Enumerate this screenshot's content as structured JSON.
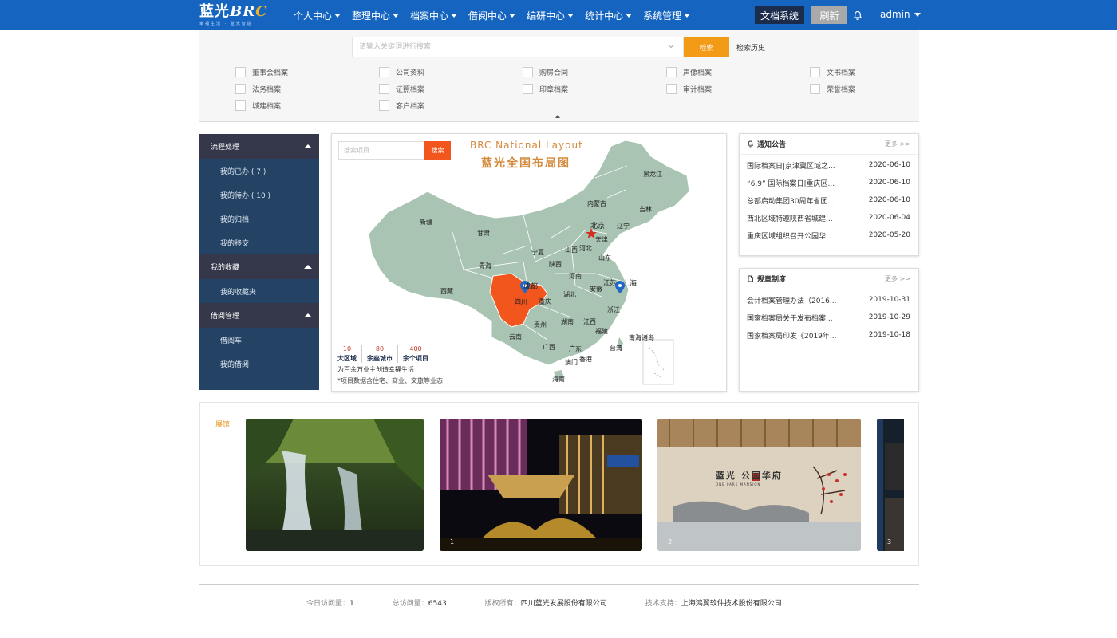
{
  "brand": {
    "logo_text_1": "蓝光",
    "logo_text_2": "BR",
    "logo_text_3": "C",
    "logo_sub": "幸福生活 · 蓝光智造",
    "primary_color": "#1565c0",
    "accent_color": "#f39a16"
  },
  "nav": {
    "items": [
      {
        "label": "个人中心"
      },
      {
        "label": "整理中心"
      },
      {
        "label": "档案中心"
      },
      {
        "label": "借阅中心"
      },
      {
        "label": "编研中心"
      },
      {
        "label": "统计中心"
      },
      {
        "label": "系统管理"
      }
    ],
    "doc_system_label": "文档系统",
    "refresh_label": "刷新",
    "user": "admin"
  },
  "search": {
    "placeholder": "请输入关键词进行搜索",
    "button": "检索",
    "history": "检索历史",
    "categories": [
      "董事会档案",
      "公司资料",
      "购房合同",
      "声像档案",
      "文书档案",
      "法务档案",
      "证照档案",
      "印章档案",
      "审计档案",
      "荣誉档案",
      "城建档案",
      "客户档案"
    ]
  },
  "sidebar": {
    "groups": [
      {
        "title": "流程处理",
        "items": [
          "我的已办 ( 7 )",
          "我的待办 ( 10 )",
          "我的归档",
          "我的移交"
        ]
      },
      {
        "title": "我的收藏",
        "items": [
          "我的收藏夹"
        ]
      },
      {
        "title": "借阅管理",
        "items": [
          "借阅车",
          "我的借阅"
        ]
      }
    ]
  },
  "map": {
    "search_placeholder": "搜索项目",
    "search_button": "搜索",
    "title_en": "BRC National Layout",
    "title_cn": "蓝光全国布局图",
    "stats": [
      {
        "num": "10",
        "label": "大区域"
      },
      {
        "num": "80",
        "label": "余座城市"
      },
      {
        "num": "400",
        "label": "余个项目"
      }
    ],
    "slogan": "为百余万业主创造幸福生活",
    "note": "*项目数据含住宅、商业、文旅等业态",
    "regions": {
      "heilongjiang": "黑龙江",
      "jilin": "吉林",
      "liaoning": "辽宁",
      "neimenggu": "内蒙古",
      "xinjiang": "新疆",
      "gansu": "甘肃",
      "beijing": "北京",
      "tianjin": "天津",
      "hebei": "河北",
      "shanxi": "山西",
      "shandong": "山东",
      "ningxia": "宁夏",
      "qinghai": "青海",
      "shaanxi": "陕西",
      "henan": "河南",
      "jiangsu": "江苏",
      "shanghai": "上海",
      "xizang": "西藏",
      "chengdu": "成都",
      "sichuan": "四川",
      "chongqing": "重庆",
      "hubei": "湖北",
      "anhui": "安徽",
      "zhejiang": "浙江",
      "guizhou": "贵州",
      "hunan": "湖南",
      "jiangxi": "江西",
      "fujian": "福建",
      "yunnan": "云南",
      "guangxi": "广西",
      "guangdong": "广东",
      "taiwan": "台湾",
      "nanhai": "南海诸岛",
      "aomen": "澳门",
      "xianggang": "香港",
      "hainan": "海南"
    },
    "highlight_color": "#f2561d",
    "base_color": "#a9c4b3"
  },
  "notice": {
    "title": "通知公告",
    "more": "更多 >>",
    "rows": [
      {
        "text": "国际档案日|京津冀区域之...",
        "date": "2020-06-10"
      },
      {
        "text": "“6.9” 国际档案日|重庆区...",
        "date": "2020-06-10"
      },
      {
        "text": "总部启动集团30周年省团...",
        "date": "2020-06-10"
      },
      {
        "text": "西北区域特邀陕西省城建...",
        "date": "2020-06-04"
      },
      {
        "text": "重庆区域组织召开公园华...",
        "date": "2020-05-20"
      }
    ]
  },
  "rules": {
    "title": "规章制度",
    "more": "更多 >>",
    "rows": [
      {
        "text": "会计档案管理办法（2016...",
        "date": "2019-10-31"
      },
      {
        "text": "国家档案局关于发布档案...",
        "date": "2019-10-29"
      },
      {
        "text": "国家档案局印发《2019年...",
        "date": "2019-10-18"
      }
    ]
  },
  "gallery": {
    "label": "展馆",
    "photos": [
      {
        "num": ""
      },
      {
        "num": "1"
      },
      {
        "num": "2"
      },
      {
        "num": "3"
      }
    ],
    "sign_text": "蓝光 公园华府",
    "sign_sub": "ONE PARK MANSION"
  },
  "footer": {
    "today_label": "今日访问量：",
    "today_value": "1",
    "total_label": "总访问量：",
    "total_value": "6543",
    "copyright_label": "版权所有：",
    "copyright_value": "四川蓝光发展股份有限公司",
    "support_label": "技术支持：",
    "support_value": "上海鸿翼软件技术股份有限公司"
  }
}
